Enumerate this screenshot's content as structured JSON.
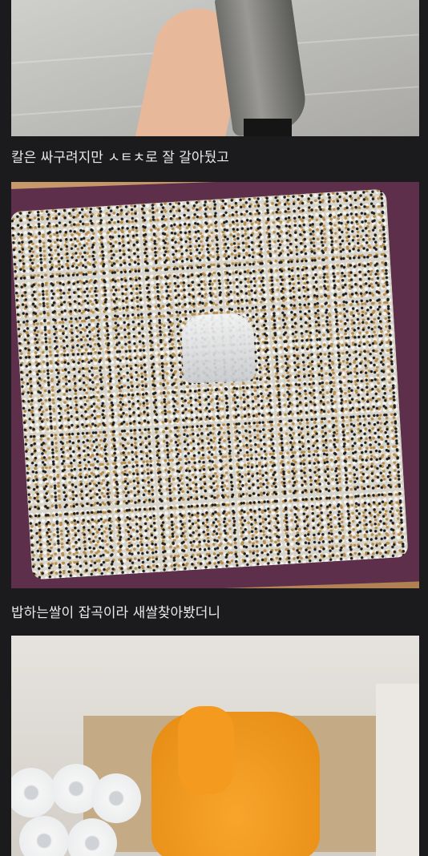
{
  "captions": {
    "first": "칼은 싸구려지만 ㅅㅌㅊ로 잘 갈아뒀고",
    "second": "밥하는쌀이 잡곡이라 새쌀찾아봤더니"
  },
  "images": {
    "knife": "knife-photo",
    "rice_bin": "rice-bin-photo",
    "rice_bag": "rice-bag-photo"
  }
}
